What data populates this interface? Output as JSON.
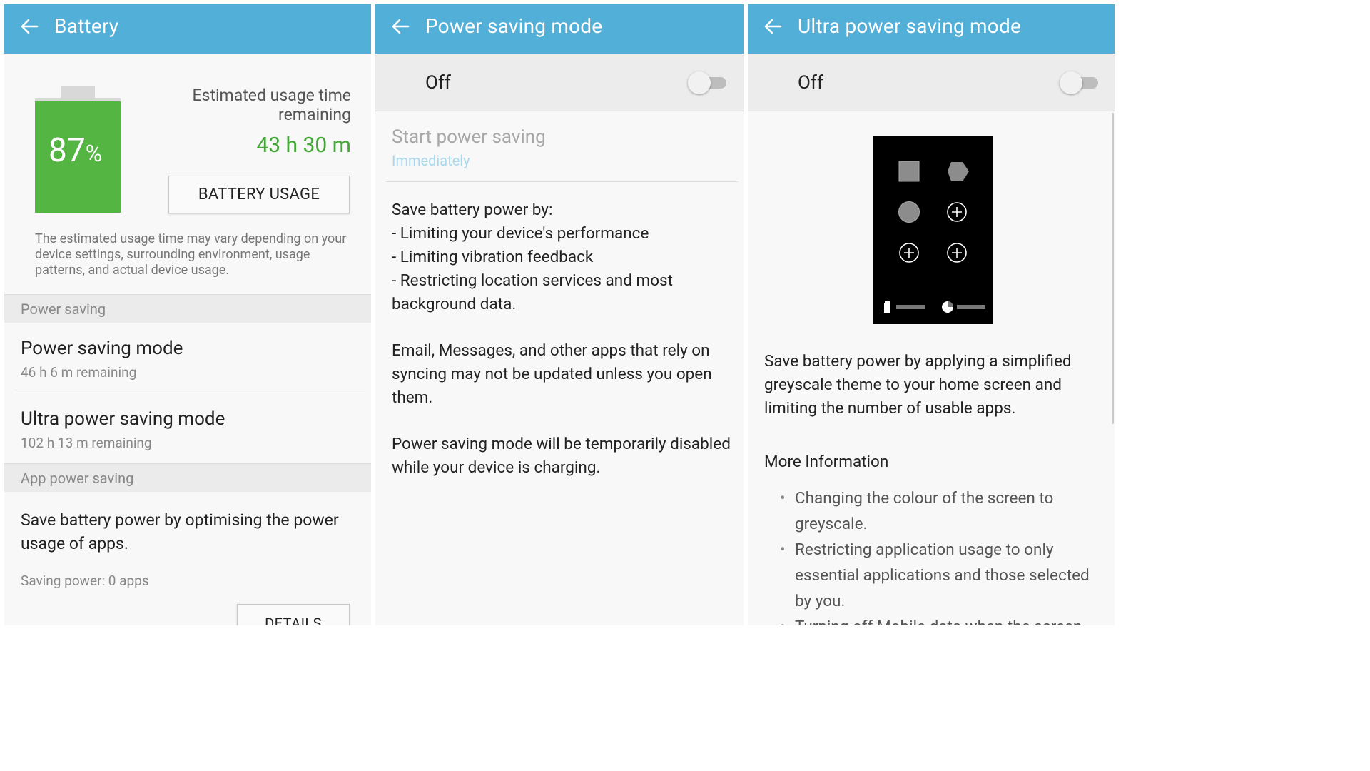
{
  "battery_panel": {
    "title": "Battery",
    "percent": "87",
    "percent_sign": "%",
    "estimated_label": "Estimated usage time remaining",
    "estimated_value": "43 h 30 m",
    "usage_button": "BATTERY USAGE",
    "disclaimer": "The estimated usage time may vary depending on your device settings, surrounding environment, usage patterns, and actual device usage.",
    "section_power_saving": "Power saving",
    "psm_title": "Power saving mode",
    "psm_remaining": "46 h 6 m remaining",
    "upsm_title": "Ultra power saving mode",
    "upsm_remaining": "102 h 13 m remaining",
    "section_app_power_saving": "App power saving",
    "app_desc": "Save battery power by optimising the power usage of apps.",
    "saving_apps": "Saving power: 0 apps",
    "details_button": "DETAILS"
  },
  "psm_panel": {
    "title": "Power saving mode",
    "toggle_label": "Off",
    "toggle_on": false,
    "start_title": "Start power saving",
    "start_value": "Immediately",
    "desc1": "Save battery power by:\n- Limiting your device's performance\n- Limiting vibration feedback\n- Restricting location services and most background data.",
    "desc2": "Email, Messages, and other apps that rely on syncing may not be updated unless you open them.",
    "desc3": "Power saving mode will be temporarily disabled while your device is charging."
  },
  "upsm_panel": {
    "title": "Ultra power saving mode",
    "toggle_label": "Off",
    "toggle_on": false,
    "desc": "Save battery power by applying a simplified greyscale theme to your home screen and limiting the number of usable apps.",
    "more_info": "More Information",
    "bullets": [
      "Changing the colour of the screen to greyscale.",
      "Restricting application usage to only essential applications and those selected by you.",
      "Turning off Mobile data when the screen"
    ]
  },
  "colors": {
    "appbar": "#52afd8",
    "battery_green": "#55b542",
    "estimate_green": "#43a636",
    "immediately_blue": "#a8d8ec"
  }
}
